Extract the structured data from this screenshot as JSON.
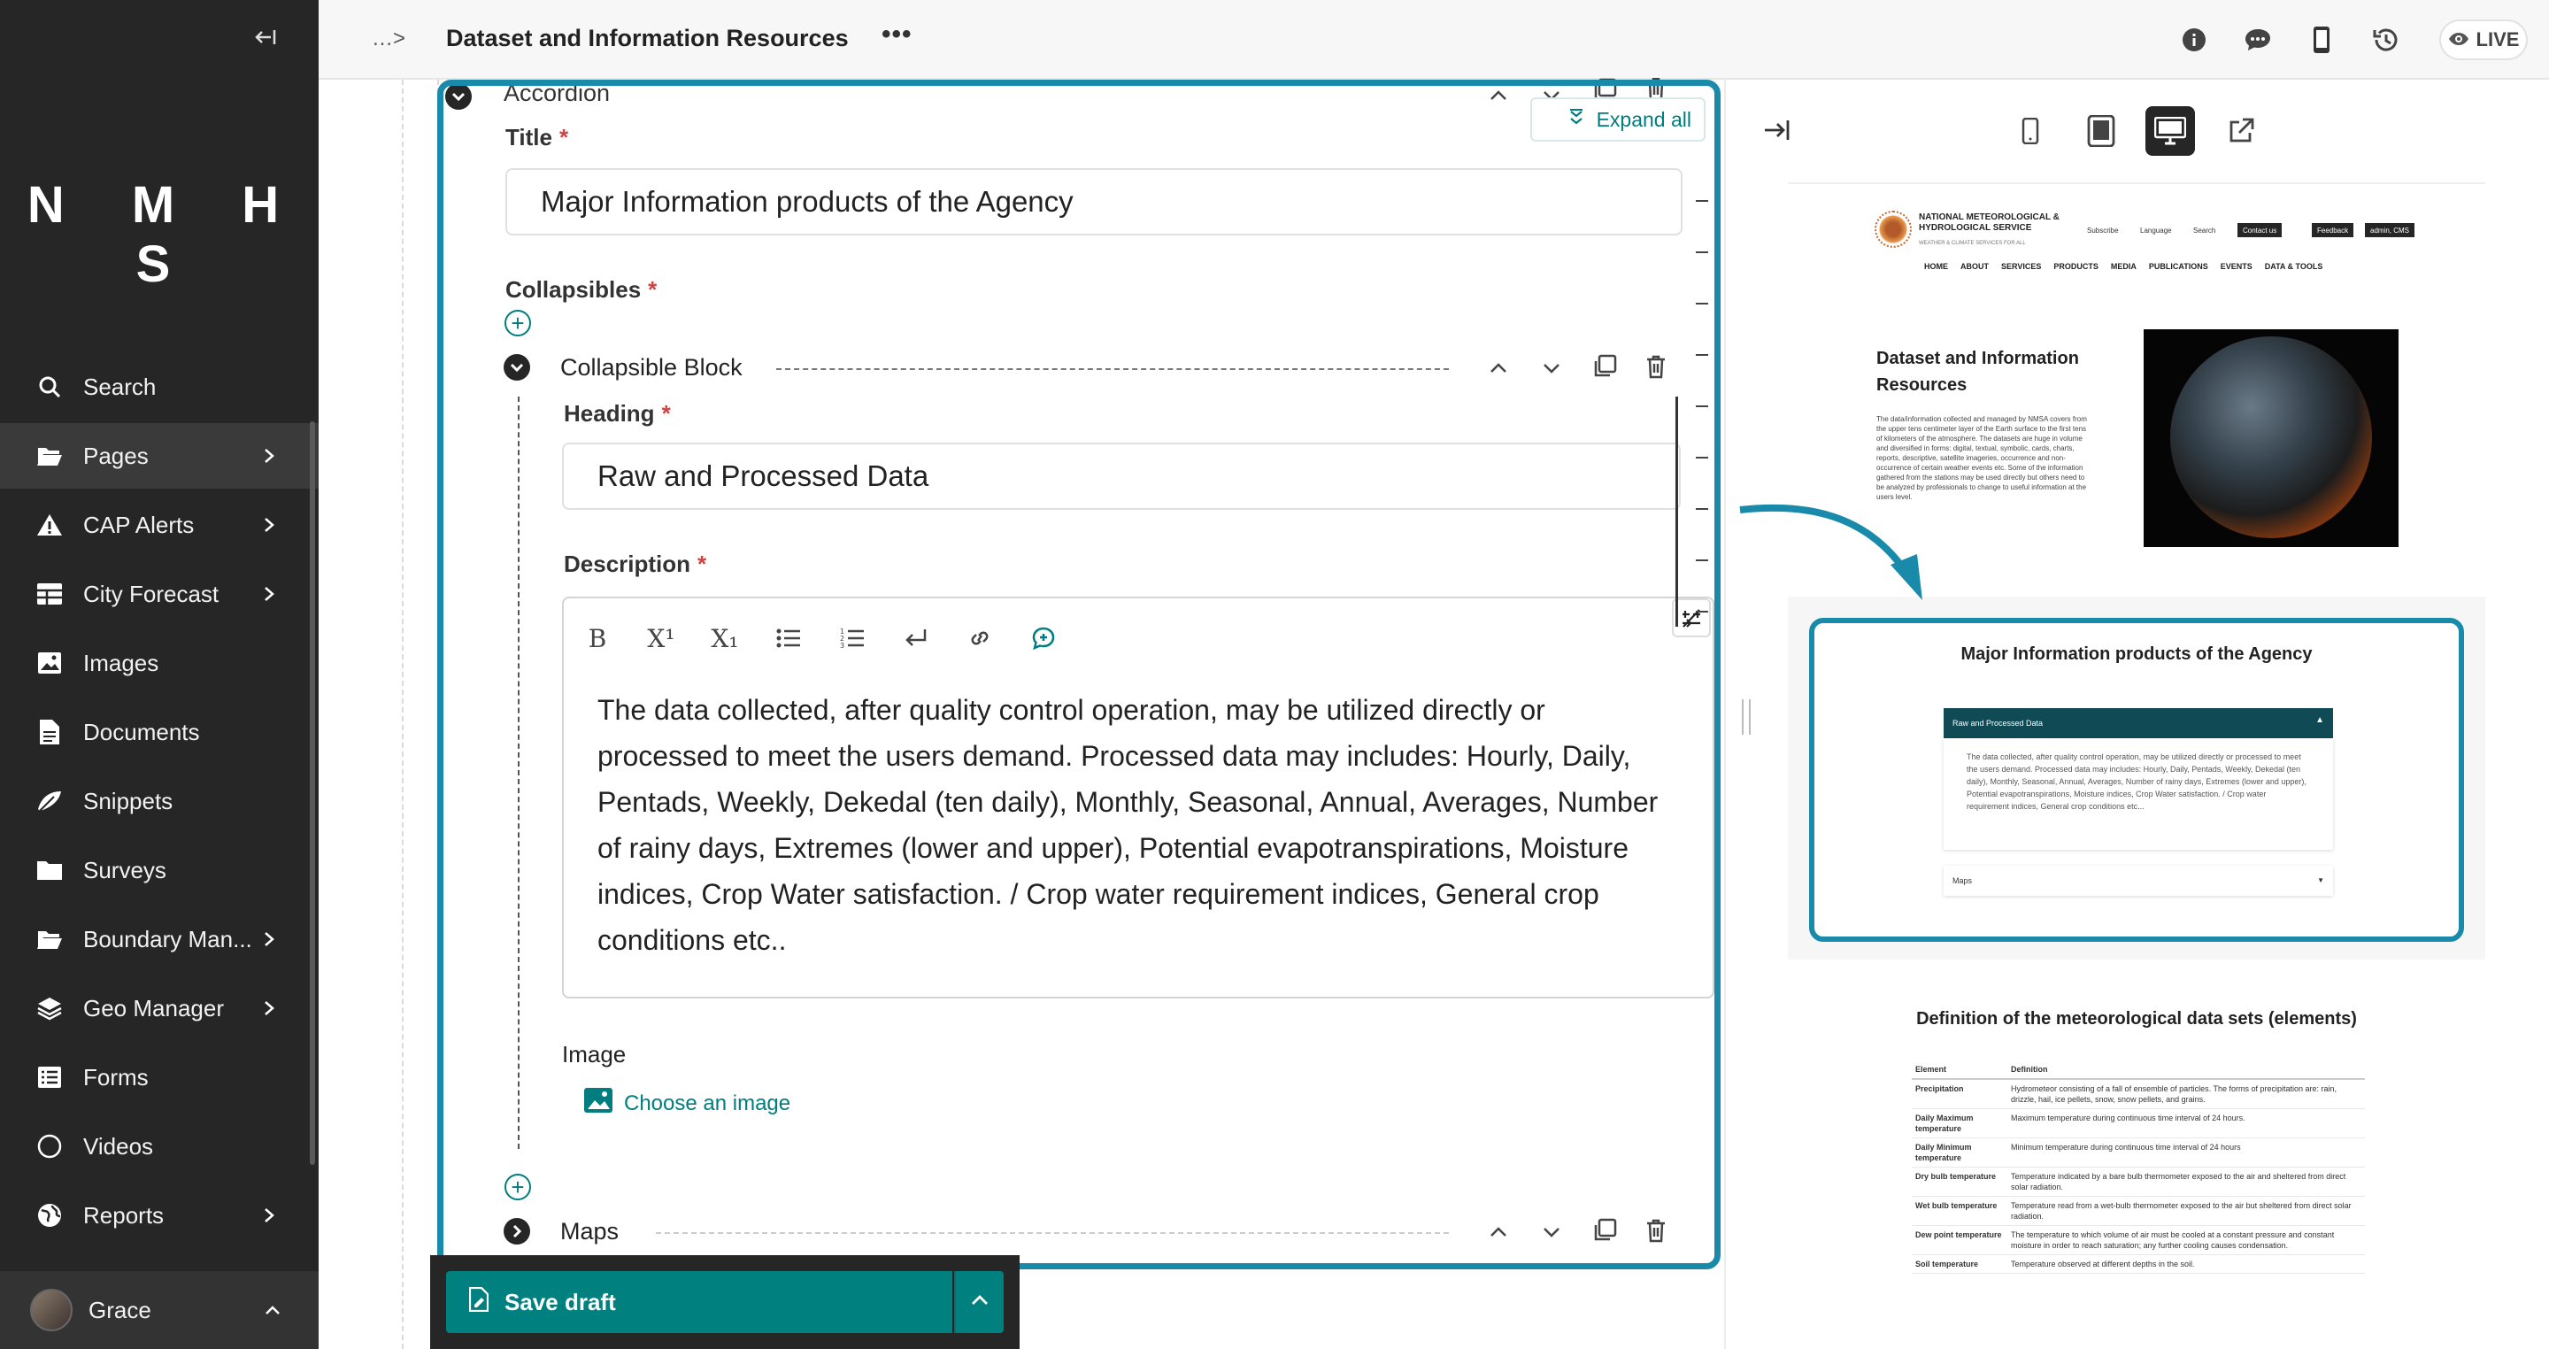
{
  "sidebar": {
    "logo": "N M H S",
    "items": [
      {
        "label": "Search",
        "icon": "search-icon",
        "has_submenu": false
      },
      {
        "label": "Pages",
        "icon": "folder-open-icon",
        "has_submenu": true
      },
      {
        "label": "CAP Alerts",
        "icon": "warning-icon",
        "has_submenu": true
      },
      {
        "label": "City Forecast",
        "icon": "table-icon",
        "has_submenu": true
      },
      {
        "label": "Images",
        "icon": "image-icon",
        "has_submenu": false
      },
      {
        "label": "Documents",
        "icon": "document-icon",
        "has_submenu": false
      },
      {
        "label": "Snippets",
        "icon": "snippet-icon",
        "has_submenu": false
      },
      {
        "label": "Surveys",
        "icon": "folder-icon",
        "has_submenu": false
      },
      {
        "label": "Boundary Man...",
        "icon": "folder-open-icon",
        "has_submenu": true
      },
      {
        "label": "Geo Manager",
        "icon": "layers-icon",
        "has_submenu": true
      },
      {
        "label": "Forms",
        "icon": "list-icon",
        "has_submenu": false
      },
      {
        "label": "Videos",
        "icon": "circle-icon",
        "has_submenu": false
      },
      {
        "label": "Reports",
        "icon": "globe-icon",
        "has_submenu": true
      }
    ],
    "user": {
      "name": "Grace"
    }
  },
  "header": {
    "breadcrumb_more": "…>",
    "title": "Dataset and Information Resources",
    "actions": "•••",
    "live_label": "LIVE"
  },
  "editor": {
    "block_type": "Accordion",
    "expand_all": "Expand all",
    "title_label": "Title",
    "title_value": "Major Information products of the Agency",
    "collapsibles_label": "Collapsibles",
    "collapsible_block_label": "Collapsible Block",
    "heading_label": "Heading",
    "heading_value": "Raw and Processed Data",
    "description_label": "Description",
    "description_text": "The data collected, after quality control operation, may be utilized directly or processed to meet the users demand. Processed data may includes: Hourly, Daily, Pentads, Weekly, Dekedal (ten daily), Monthly, Seasonal, Annual, Averages, Number of rainy days, Extremes (lower and upper), Potential evapotranspirations, Moisture indices, Crop Water satisfaction. / Crop water requirement indices, General crop conditions etc..",
    "image_label": "Image",
    "choose_image": "Choose an image",
    "maps_label": "Maps",
    "toolbar": {
      "bold": "B",
      "superscript": "X¹",
      "subscript": "X₁"
    }
  },
  "footer": {
    "save_label": "Save draft"
  },
  "preview": {
    "org_name": "NATIONAL METEOROLOGICAL & HYDROLOGICAL SERVICE",
    "tagline": "WEATHER & CLIMATE SERVICES FOR ALL",
    "subscribe": "Subscribe",
    "language": "Language",
    "search": "Search",
    "contact_btn": "Contact us",
    "feedback_btn": "Feedback",
    "admin_btn": "admin, CMS",
    "nav": [
      "HOME",
      "ABOUT",
      "SERVICES",
      "PRODUCTS",
      "MEDIA",
      "PUBLICATIONS",
      "EVENTS",
      "DATA & TOOLS"
    ],
    "page_title": "Dataset and Information Resources",
    "page_desc": "The data/information collected and managed by NMSA covers from the upper tens centimeter layer of the Earth surface to the first tens of kilometers of the atmosphere. The datasets are huge in volume and diversified in forms: digital, textual, symbolic, cards, charts, reports, descriptive, satellite imageries, occurrence and non-occurrence of certain weather events etc. Some of the information gathered from the stations may be used directly but others need to be analyzed by professionals to change to useful information at the users level.",
    "accordion_title": "Major Information products of the Agency",
    "acc_item1": "Raw and Processed Data",
    "acc_item1_body": "The data collected, after quality control operation, may be utilized directly or processed to meet the users demand. Processed data may includes: Hourly, Daily, Pentads, Weekly, Dekedal (ten daily), Monthly, Seasonal, Annual, Averages, Number of rainy days, Extremes (lower and upper), Potential evapotranspirations, Moisture indices, Crop Water satisfaction. / Crop water requirement indices, General crop conditions etc...",
    "acc_item2": "Maps",
    "definitions_title": "Definition of the meteorological data sets (elements)",
    "table_headers": [
      "Element",
      "Definition"
    ],
    "table_rows": [
      [
        "Precipitation",
        "Hydrometeor consisting of a fall of ensemble of particles. The forms of precipitation are: rain, drizzle, hail, ice pellets, snow, snow pellets, and grains."
      ],
      [
        "Daily Maximum temperature",
        "Maximum temperature during continuous time interval of 24 hours."
      ],
      [
        "Daily Minimum temperature",
        "Minimum temperature during continuous time interval of 24 hours"
      ],
      [
        "Dry bulb temperature",
        "Temperature indicated by a bare bulb thermometer exposed to the air and sheltered from direct solar radiation."
      ],
      [
        "Wet bulb temperature",
        "Temperature read from a wet-bulb thermometer exposed to the air but sheltered from direct solar radiation."
      ],
      [
        "Dew point temperature",
        "The temperature to which volume of air must be cooled at a constant pressure and constant moisture in order to reach saturation; any further cooling causes condensation."
      ],
      [
        "Soil temperature",
        "Temperature observed at different depths in the soil."
      ]
    ]
  },
  "colors": {
    "accent": "#007d7e",
    "highlight": "#1a8aaa",
    "sidebar": "#262626",
    "required": "#cd4444"
  }
}
